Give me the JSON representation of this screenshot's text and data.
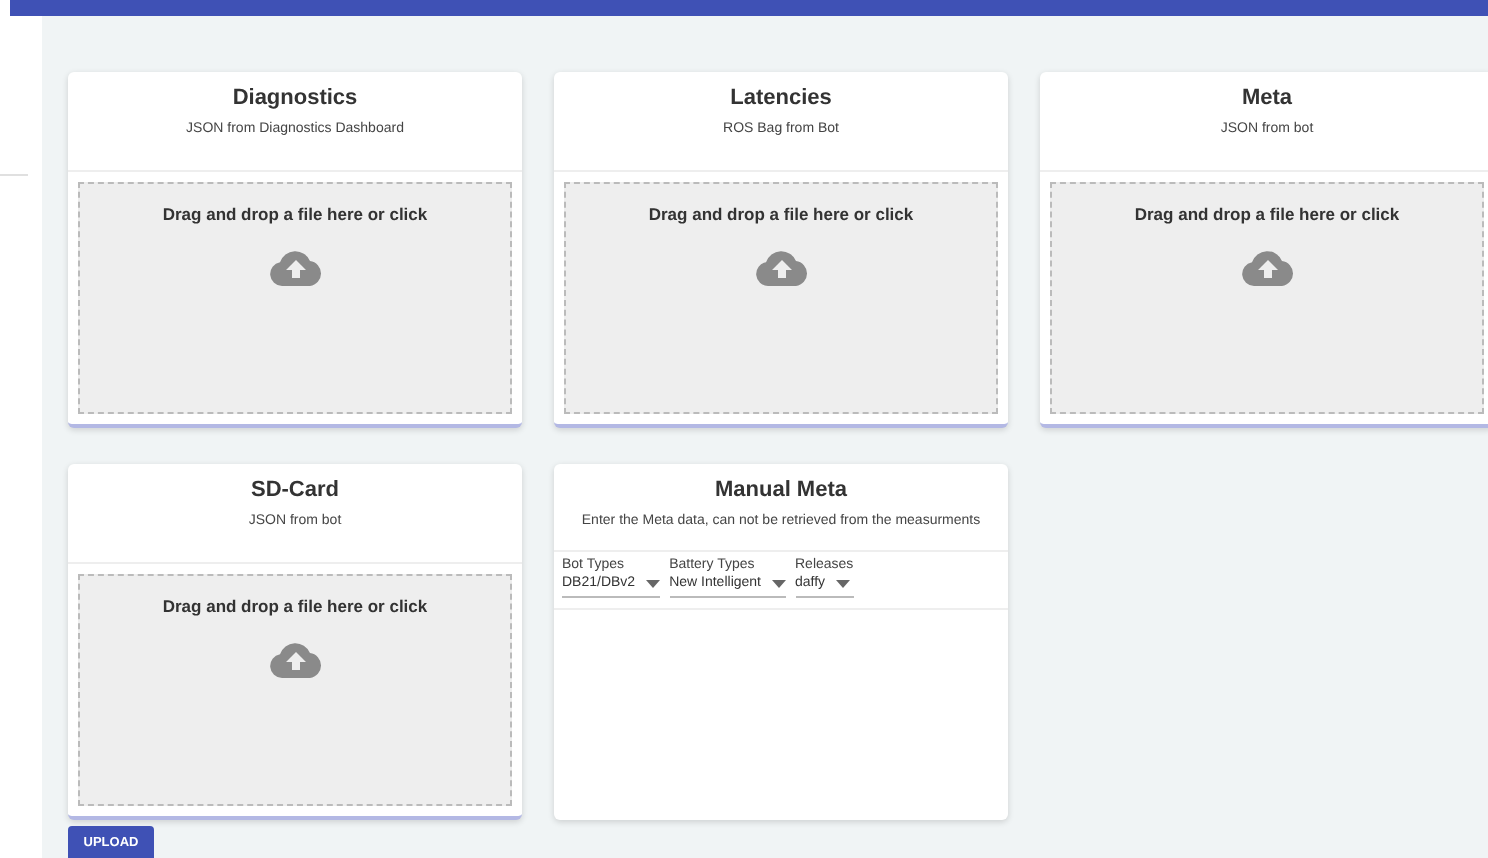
{
  "upload_cards": [
    {
      "title": "Diagnostics",
      "subtitle": "JSON from Diagnostics Dashboard",
      "dropzone": "Drag and drop a file here or click"
    },
    {
      "title": "Latencies",
      "subtitle": "ROS Bag from Bot",
      "dropzone": "Drag and drop a file here or click"
    },
    {
      "title": "Meta",
      "subtitle": "JSON from bot",
      "dropzone": "Drag and drop a file here or click"
    },
    {
      "title": "SD-Card",
      "subtitle": "JSON from bot",
      "dropzone": "Drag and drop a file here or click"
    }
  ],
  "manual_meta": {
    "title": "Manual Meta",
    "subtitle": "Enter the Meta data, can not be retrieved from the measurments",
    "fields": [
      {
        "label": "Bot Types",
        "value": "DB21/DBv2"
      },
      {
        "label": "Battery Types",
        "value": "New Intelligent"
      },
      {
        "label": "Releases",
        "value": "daffy"
      }
    ]
  },
  "upload_button": "UPLOAD"
}
